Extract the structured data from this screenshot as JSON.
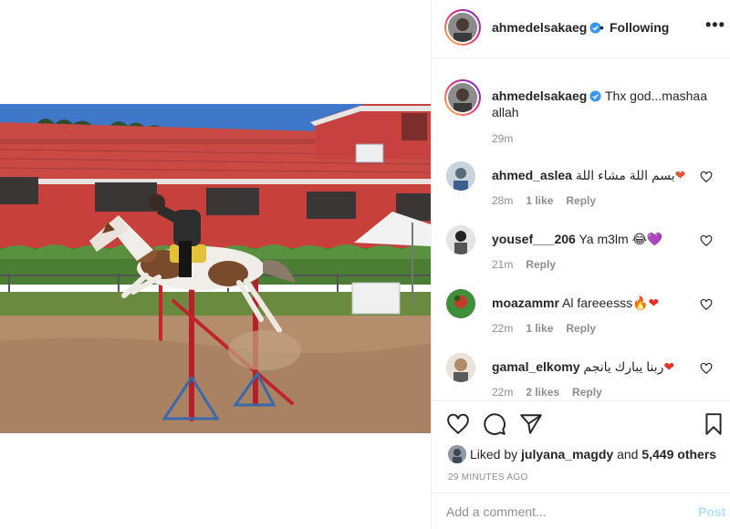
{
  "header": {
    "username": "ahmedelsakaeg",
    "dot": "•",
    "follow_status": "Following",
    "more": "•••"
  },
  "caption": {
    "username": "ahmedelsakaeg",
    "text": "Thx god...mashaa allah",
    "time": "29m"
  },
  "comments": [
    {
      "username": "ahmed_aslea",
      "text": "بسم اللة مشاء اللة",
      "emoji": "❤",
      "time": "28m",
      "likes": "1 like",
      "reply": "Reply",
      "avatar_color": "#c9d3db"
    },
    {
      "username": "yousef___206",
      "text": "Ya m3lm",
      "emoji": "😂💜",
      "time": "21m",
      "likes": "",
      "reply": "Reply",
      "avatar_color": "#d8d8d8"
    },
    {
      "username": "moazammr",
      "text": "Al fareeesss",
      "emoji": "🔥❤",
      "time": "22m",
      "likes": "1 like",
      "reply": "Reply",
      "avatar_color": "#3f8f3a"
    },
    {
      "username": "gamal_elkomy",
      "text": "ربنا يبارك يانجم",
      "emoji": "❤",
      "time": "22m",
      "likes": "2 likes",
      "reply": "Reply",
      "avatar_color": "#b08b6a"
    }
  ],
  "likes": {
    "prefix": "Liked by",
    "user": "julyana_magdy",
    "and": "and",
    "count": "5,449 others"
  },
  "timestamp": "29 MINUTES AGO",
  "add_comment": {
    "placeholder": "Add a comment...",
    "post_label": "Post"
  },
  "colors": {
    "accent_blue": "#0095f6",
    "post_disabled": "#b2dffc",
    "muted": "#8e8e8e",
    "heart_red": "#ed4956"
  }
}
